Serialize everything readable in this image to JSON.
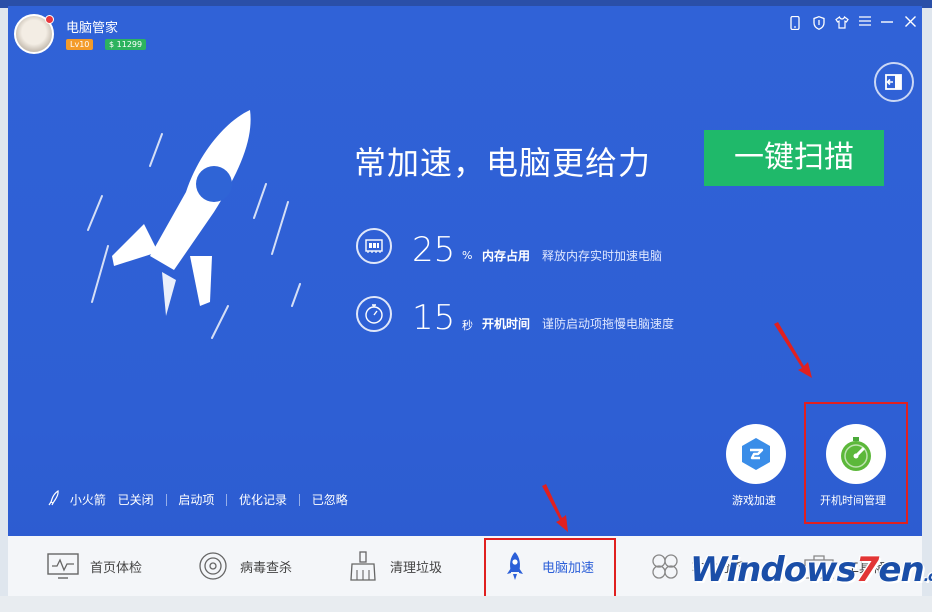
{
  "window": {
    "title": "电脑管家",
    "level_badge": "Lv10",
    "coins_badge": "$ 11299"
  },
  "hero": {
    "headline": "常加速，电脑更给力",
    "scan_button": "一键扫描"
  },
  "stats": [
    {
      "value": "25",
      "unit": "%",
      "label": "内存占用",
      "desc": "释放内存实时加速电脑"
    },
    {
      "value": "15",
      "unit": "秒",
      "label": "开机时间",
      "desc": "谨防启动项拖慢电脑速度"
    }
  ],
  "tools": [
    {
      "label": "游戏加速"
    },
    {
      "label": "开机时间管理"
    }
  ],
  "status_bar": {
    "rocket_label": "小火箭",
    "rocket_state": "已关闭",
    "startup": "启动项",
    "optimize_log": "优化记录",
    "ignored": "已忽略"
  },
  "nav": [
    {
      "label": "首页体检"
    },
    {
      "label": "病毒查杀"
    },
    {
      "label": "清理垃圾"
    },
    {
      "label": "电脑加速",
      "active": true
    },
    {
      "label": "软件分析"
    },
    {
      "label": "工具箱"
    }
  ],
  "watermark": {
    "w1": "Windows",
    "seven": "7",
    "w2": "en",
    "com": ".com"
  },
  "colors": {
    "window_blue": "#2f64d6",
    "scan_green": "#1fb96a",
    "annotation_red": "#e02020"
  }
}
